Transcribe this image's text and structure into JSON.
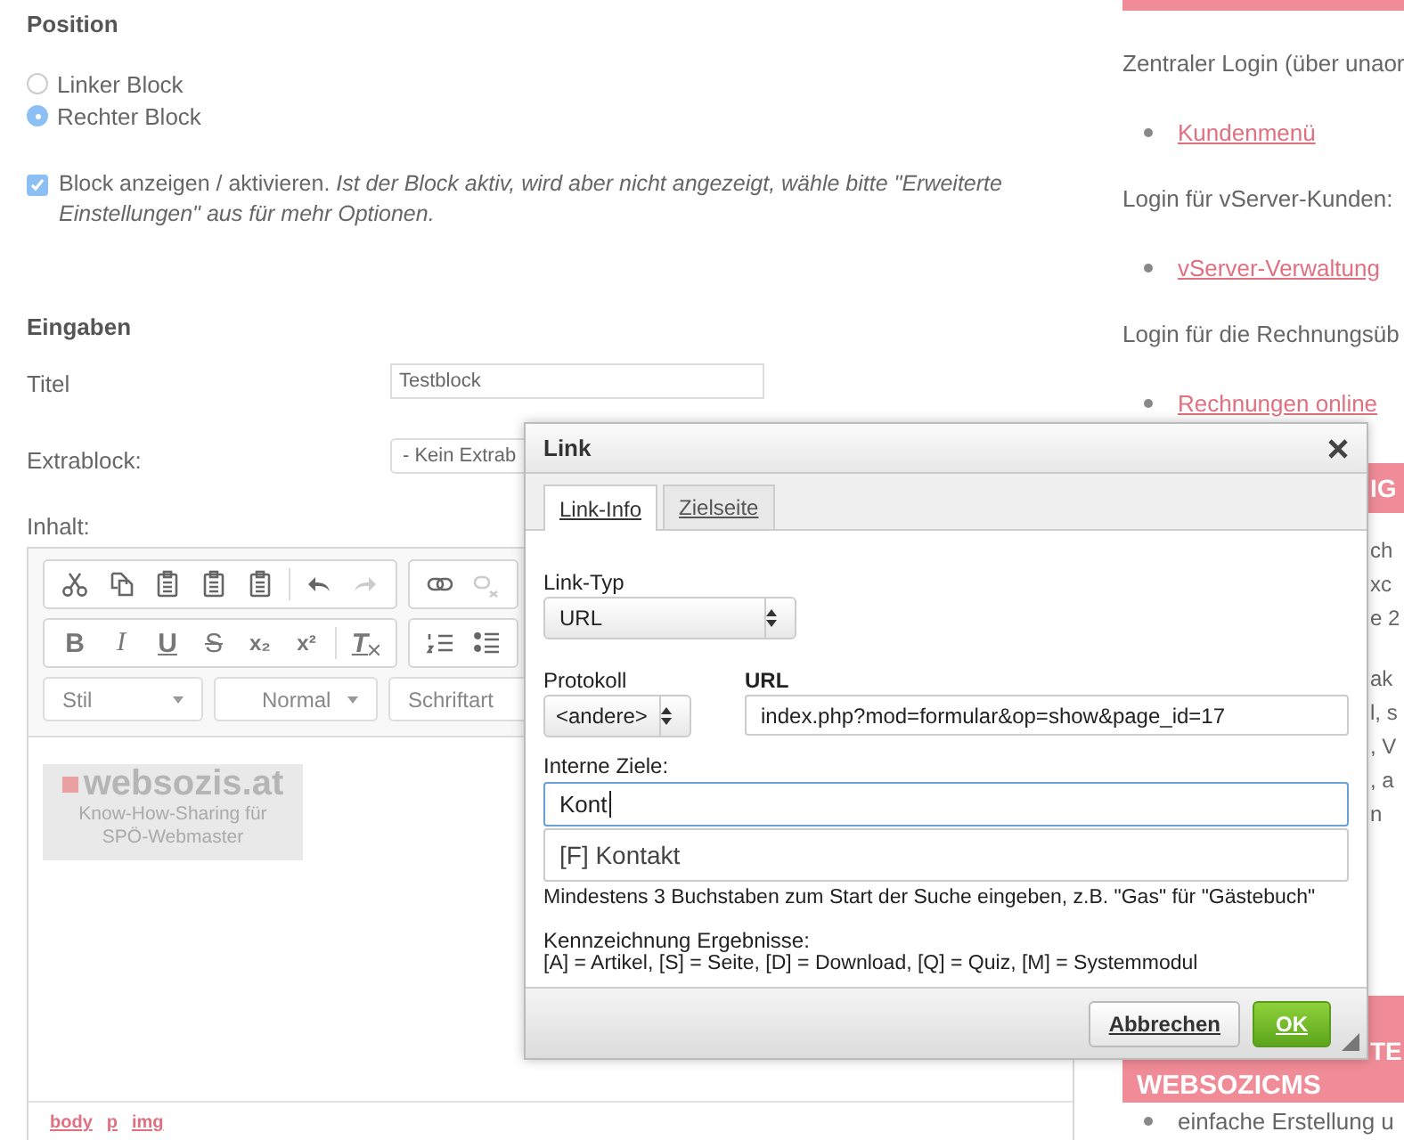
{
  "position": {
    "heading": "Position",
    "options": [
      {
        "label": "Linker Block",
        "selected": false
      },
      {
        "label": "Rechter Block",
        "selected": true
      }
    ]
  },
  "block_active": {
    "checked": true,
    "text": "Block anzeigen / aktivieren. *Ist der Block aktiv, wird aber nicht angezeigt, wähle bitte \"Erweiterte Einstellungen\" aus für mehr Optionen.*"
  },
  "inputs": {
    "heading": "Eingaben",
    "title_label": "Titel",
    "title_value": "Testblock",
    "extrablock_label": "Extrablock:",
    "extrablock_value": "- Kein Extrab",
    "content_label": "Inhalt:"
  },
  "editor": {
    "toolbar_rows": [
      [
        [
          {
            "kind": "cut"
          },
          {
            "kind": "copy"
          },
          {
            "kind": "paste"
          },
          {
            "kind": "paste_text"
          },
          {
            "kind": "paste_word"
          },
          {
            "kind": "sep"
          },
          {
            "kind": "undo"
          },
          {
            "kind": "redo",
            "disabled": true
          }
        ],
        [
          {
            "kind": "link"
          },
          {
            "kind": "unlink",
            "disabled": true
          }
        ]
      ],
      [
        [
          {
            "kind": "bold",
            "label": "B"
          },
          {
            "kind": "italic",
            "label": "I"
          },
          {
            "kind": "underline",
            "label": "U"
          },
          {
            "kind": "strike",
            "label": "S"
          },
          {
            "kind": "sub",
            "label": "x₂"
          },
          {
            "kind": "sup",
            "label": "x²"
          },
          {
            "kind": "sep"
          },
          {
            "kind": "clear",
            "label": "T"
          }
        ],
        [
          {
            "kind": "ol"
          },
          {
            "kind": "ul"
          }
        ]
      ]
    ],
    "styles": [
      "Stil",
      "Normal",
      "Schriftart"
    ],
    "logo": {
      "name": "websozis.at",
      "tagline": "Know-How-Sharing für SPÖ-Webmaster"
    },
    "path": [
      "body",
      "p",
      "img"
    ]
  },
  "sidebar": {
    "logins": [
      {
        "text": "Zentraler Login (über unaor",
        "link": "Kundenmenü"
      },
      {
        "text": "Login für vServer-Kunden:",
        "link": "vServer-Verwaltung"
      },
      {
        "text": "Login für die Rechnungsüb",
        "link": "Rechnungen online"
      }
    ],
    "heading_1": "IG",
    "paragraphs": [
      [
        "ch",
        "xc",
        "e 2"
      ],
      [
        "ak",
        "l, s",
        ", V",
        ", a",
        "n"
      ]
    ],
    "heading_2": [
      "TE",
      "WEBSOZICMS"
    ],
    "bullets": [
      "einfache Erstellung u"
    ]
  },
  "dialog": {
    "title": "Link",
    "tabs": [
      {
        "label": "Link-Info",
        "selected": true
      },
      {
        "label": "Zielseite",
        "selected": false
      }
    ],
    "link_type_label": "Link-Typ",
    "link_type_value": "URL",
    "protocol_label": "Protokoll",
    "protocol_value": "<andere>",
    "url_label": "URL",
    "url_value": "index.php?mod=formular&op=show&page_id=17",
    "internal_label": "Interne Ziele:",
    "internal_value": "Kont",
    "suggestions": [
      "[F] Kontakt"
    ],
    "hint": "Mindestens 3 Buchstaben zum Start der Suche eingeben, z.B. \"Gas\" für \"Gästebuch\"",
    "legend_title": "Kennzeichnung Ergebnisse:",
    "legend": "[A] = Artikel, [S] = Seite, [D] = Download, [Q] = Quiz, [M] = Systemmodul",
    "buttons": {
      "cancel": "Abbrechen",
      "ok": "OK"
    }
  }
}
